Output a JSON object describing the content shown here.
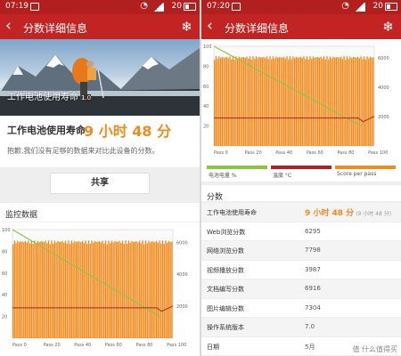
{
  "left": {
    "status": {
      "time": "07:19",
      "battery": "20"
    },
    "appbar": {
      "title": "分数详细信息"
    },
    "hero": {
      "caption": "工作电池使用寿命",
      "version": "1.0"
    },
    "life": {
      "label": "工作电池使用寿命",
      "value": "9 小时 48 分"
    },
    "notice": "抱歉,我们没有足够的数据来对比此设备的分数。",
    "share_label": "共享",
    "monitor_title": "监控数据"
  },
  "right": {
    "status": {
      "time": "07:20",
      "battery": "20"
    },
    "appbar": {
      "title": "分数详细信息"
    },
    "legend": [
      {
        "label": "电池电量 %",
        "color": "#8cc63f"
      },
      {
        "label": "温度 °C",
        "color": "#b22222"
      },
      {
        "label": "Score per pass",
        "color": "#f28a1c"
      }
    ],
    "scores_title": "分数",
    "rows": [
      {
        "key": "工作电池使用寿命",
        "value": "9 小时 48 分",
        "sub": "(9 小时 48 分)"
      },
      {
        "key": "Web浏览分数",
        "value": "6295"
      },
      {
        "key": "网络浏览分数",
        "value": "7798"
      },
      {
        "key": "视频播放分数",
        "value": "3987"
      },
      {
        "key": "文档编写分数",
        "value": "6916"
      },
      {
        "key": "图片编辑分数",
        "value": "7304"
      },
      {
        "key": "操作系统版本",
        "value": "7.0"
      },
      {
        "key": "日期",
        "value": "5月"
      }
    ],
    "watermark": "值 什么值得买"
  },
  "chart_data": [
    {
      "type": "bar",
      "x_tick_labels": [
        "Pass 0",
        "Pass 20",
        "Pass 40",
        "Pass 60",
        "Pass 80",
        "Pass 100"
      ],
      "y_left_ticks": [
        100,
        80,
        60,
        40,
        20
      ],
      "y_right_ticks": [
        6000,
        4000,
        2000
      ],
      "ylim_left": [
        0,
        100
      ],
      "ylim_right": [
        0,
        6800
      ],
      "passes": 104,
      "series": [
        {
          "name": "Score per pass",
          "color": "#f28a1c",
          "approx_value": 6000
        },
        {
          "name": "电池电量 %",
          "color": "#8cc63f",
          "start": 100,
          "end": 20
        },
        {
          "name": "温度 °C",
          "color": "#b22222",
          "approx_value": 28
        }
      ]
    }
  ]
}
